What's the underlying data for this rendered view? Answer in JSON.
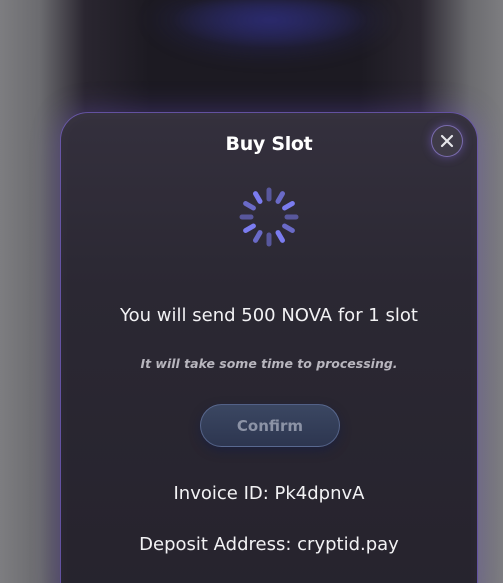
{
  "modal": {
    "title": "Buy Slot",
    "close_icon": "close-icon",
    "spinner_icon": "loading-spinner-icon",
    "message": "You will send 500 NOVA for 1 slot",
    "note": "It will take some time to processing.",
    "confirm_label": "Confirm",
    "invoice_label": "Invoice ID: Pk4dpnvA",
    "deposit_label": "Deposit Address: cryptid.pay"
  },
  "colors": {
    "accent": "#7b7cf0",
    "modal_background": "#2b2833",
    "button_background": "#34405a",
    "button_text": "#8c93a6"
  }
}
